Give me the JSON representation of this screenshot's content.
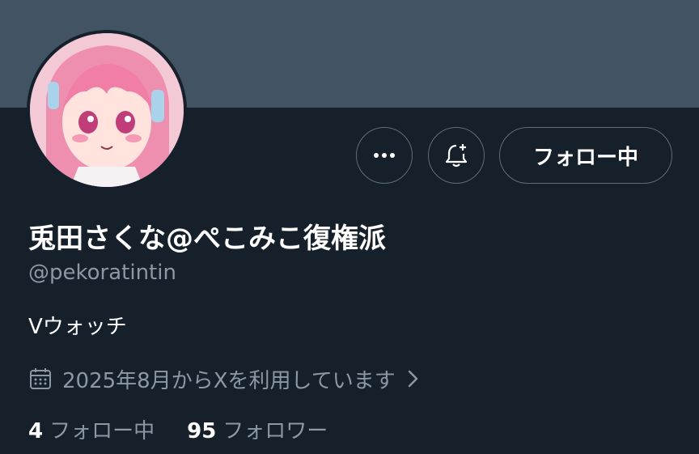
{
  "profile": {
    "display_name": "兎田さくな@ぺこみこ復権派",
    "handle": "@pekoratintin",
    "bio": "Vウォッチ",
    "joined": "2025年8月からXを利用しています"
  },
  "actions": {
    "more_icon": "more-horizontal-icon",
    "notify_icon": "bell-plus-icon",
    "follow_label": "フォロー中"
  },
  "stats": {
    "following_count": "4",
    "following_label": "フォロー中",
    "followers_count": "95",
    "followers_label": "フォロワー"
  },
  "colors": {
    "background": "#15202b",
    "banner": "#425364",
    "secondary_text": "#8b98a5",
    "border": "#5c6e7e"
  }
}
